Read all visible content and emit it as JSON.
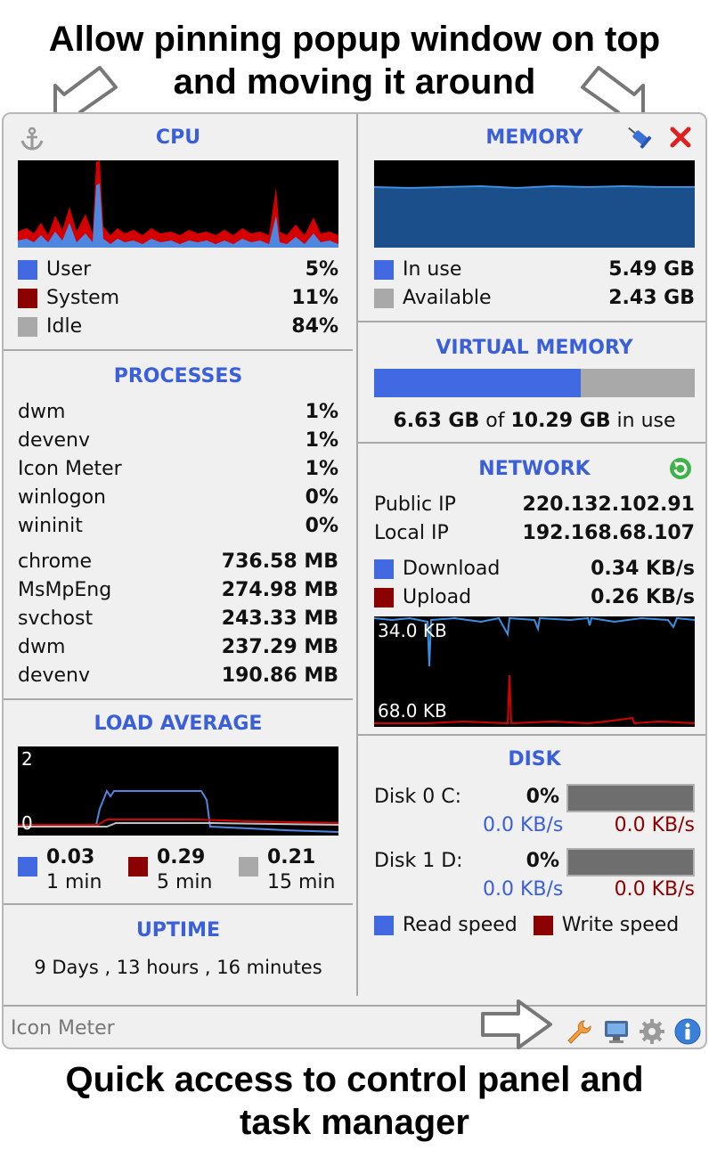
{
  "captions": {
    "top_line1": "Allow pinning popup window on top",
    "top_line2": "and moving it around",
    "bottom_line1": "Quick access to control panel and",
    "bottom_line2": "task manager"
  },
  "colors": {
    "accent": "#3a5fd8",
    "user": "#4169e1",
    "system": "#8b0000",
    "idle": "#a9a9a9"
  },
  "cpu": {
    "title": "CPU",
    "rows": [
      {
        "label": "User",
        "value": "5%"
      },
      {
        "label": "System",
        "value": "11%"
      },
      {
        "label": "Idle",
        "value": "84%"
      }
    ]
  },
  "memory": {
    "title": "MEMORY",
    "rows": [
      {
        "label": "In use",
        "value": "5.49 GB"
      },
      {
        "label": "Available",
        "value": "2.43 GB"
      }
    ]
  },
  "virtual_memory": {
    "title": "VIRTUAL MEMORY",
    "used": "6.63 GB",
    "of": "of",
    "total": "10.29 GB",
    "suffix": "in use",
    "fraction": 0.644
  },
  "processes": {
    "title": "PROCESSES",
    "cpu": [
      {
        "name": "dwm",
        "value": "1%"
      },
      {
        "name": "devenv",
        "value": "1%"
      },
      {
        "name": "Icon Meter",
        "value": "1%"
      },
      {
        "name": "winlogon",
        "value": "0%"
      },
      {
        "name": "wininit",
        "value": "0%"
      }
    ],
    "memory": [
      {
        "name": "chrome",
        "value": "736.58 MB"
      },
      {
        "name": "MsMpEng",
        "value": "274.98 MB"
      },
      {
        "name": "svchost",
        "value": "243.33 MB"
      },
      {
        "name": "dwm",
        "value": "237.29 MB"
      },
      {
        "name": "devenv",
        "value": "190.86 MB"
      }
    ]
  },
  "network": {
    "title": "NETWORK",
    "public_ip_label": "Public IP",
    "public_ip": "220.132.102.91",
    "local_ip_label": "Local IP",
    "local_ip": "192.168.68.107",
    "download_label": "Download",
    "download": "0.34 KB/s",
    "upload_label": "Upload",
    "upload": "0.26 KB/s",
    "graph_top": "34.0 KB",
    "graph_bottom": "68.0 KB"
  },
  "load_average": {
    "title": "LOAD AVERAGE",
    "graph_top": "2",
    "graph_bottom": "0",
    "items": [
      {
        "value": "0.03",
        "label": "1 min"
      },
      {
        "value": "0.29",
        "label": "5 min"
      },
      {
        "value": "0.21",
        "label": "15 min"
      }
    ]
  },
  "disk": {
    "title": "DISK",
    "disks": [
      {
        "label": "Disk 0 C:",
        "value": "0%",
        "read": "0.0 KB/s",
        "write": "0.0 KB/s"
      },
      {
        "label": "Disk 1 D:",
        "value": "0%",
        "read": "0.0 KB/s",
        "write": "0.0 KB/s"
      }
    ],
    "legend_read": "Read speed",
    "legend_write": "Write speed"
  },
  "uptime": {
    "title": "UPTIME",
    "value": "9 Days , 13 hours , 16 minutes"
  },
  "footer": {
    "title": "Icon Meter",
    "icons": [
      "wrench-icon",
      "monitor-icon",
      "gear-icon",
      "info-icon"
    ]
  }
}
